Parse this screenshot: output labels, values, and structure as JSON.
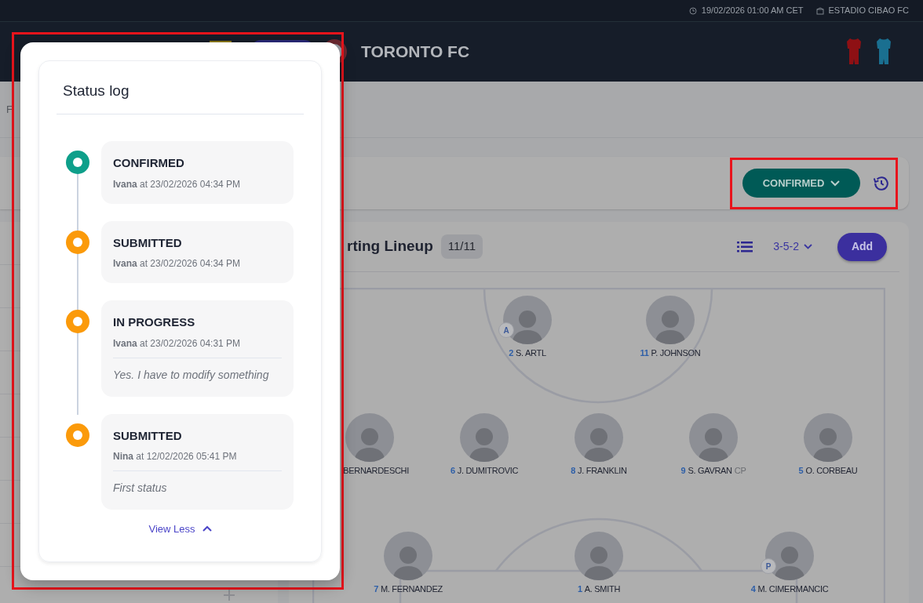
{
  "top_bar": {
    "datetime": "19/02/2026 01:00 AM CET",
    "stadium": "ESTADIO CIBAO FC"
  },
  "header": {
    "team": "TORONTO FC"
  },
  "tabs": [
    {
      "label": "F"
    }
  ],
  "status_bar": {
    "status": "CONFIRMED"
  },
  "lineup": {
    "title": "rting Lineup",
    "count": "11/11",
    "formation": "3-5-2",
    "add": "Add",
    "lines": [
      {
        "players": [
          {
            "number": "2",
            "name": "S. ARTL",
            "badge": "A"
          },
          {
            "number": "11",
            "name": "P. JOHNSON"
          }
        ]
      },
      {
        "players": [
          {
            "name": "BERNARDESCHI"
          },
          {
            "number": "6",
            "name": "J. DUMITROVIC"
          },
          {
            "number": "8",
            "name": "J. FRANKLIN"
          },
          {
            "number": "9",
            "name": "S. GAVRAN",
            "tag": "CP"
          },
          {
            "number": "5",
            "name": "O. CORBEAU"
          }
        ]
      },
      {
        "players": [
          {
            "number": "7",
            "name": "M. FERNANDEZ"
          },
          {
            "number": "1",
            "name": "A. SMITH"
          },
          {
            "number": "4",
            "name": "M. CIMERMANCIC",
            "badge": "P"
          }
        ]
      }
    ]
  },
  "status_log": {
    "title": "Status log",
    "toggle": "View Less",
    "entries": [
      {
        "status": "CONFIRMED",
        "meta": "**Ivana** at 23/02/2026 04:34 PM",
        "color": "#0e9f8a"
      },
      {
        "status": "SUBMITTED",
        "meta": "**Ivana** at 23/02/2026 04:34 PM",
        "color": "#fb9a0a"
      },
      {
        "status": "IN PROGRESS",
        "meta": "**Ivana** at 23/02/2026 04:31 PM",
        "comment": "Yes. I have to modify something",
        "color": "#fb9a0a"
      },
      {
        "status": "SUBMITTED",
        "meta": "**Nina** at 12/02/2026 05:41 PM",
        "comment": "First status",
        "color": "#fb9a0a"
      }
    ]
  }
}
